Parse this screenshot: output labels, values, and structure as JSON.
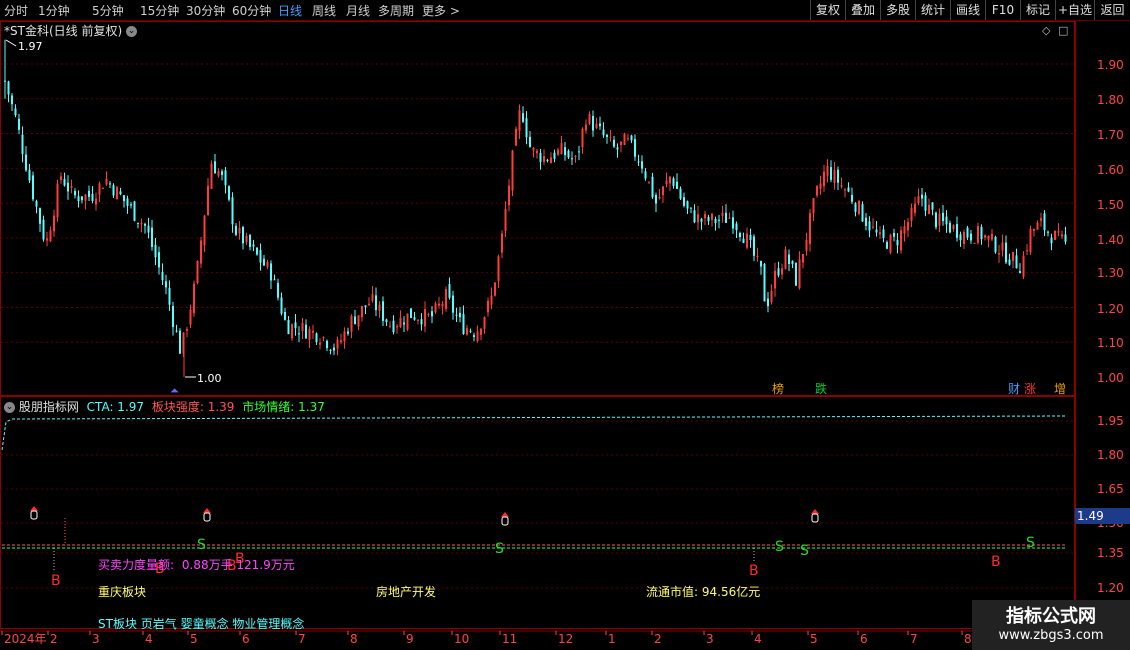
{
  "toolbar": {
    "periods": [
      "分时",
      "1分钟",
      "5分钟",
      "15分钟",
      "30分钟",
      "60分钟",
      "日线",
      "周线",
      "月线",
      "多周期",
      "更多 >"
    ],
    "active_period": "日线",
    "tools": [
      "复权",
      "叠加",
      "多股",
      "统计",
      "画线",
      "F10",
      "标记",
      "+自选",
      "返回"
    ]
  },
  "main_panel": {
    "title": "*ST金科(日线 前复权)",
    "high_label": "1.97",
    "low_label": "1.00",
    "price_axis": [
      "1.90",
      "1.80",
      "1.70",
      "1.60",
      "1.50",
      "1.40",
      "1.30",
      "1.20",
      "1.10",
      "1.00"
    ],
    "markers": [
      {
        "text": "榜",
        "color": "#e8a000"
      },
      {
        "text": "跌",
        "color": "#00cc33"
      },
      {
        "text": "财",
        "color": "#3ea0ff"
      },
      {
        "text": "涨",
        "color": "#ff3333"
      },
      {
        "text": "增",
        "color": "#e8a000"
      }
    ]
  },
  "indicator_panel": {
    "name": "股朋指标网",
    "cta_label": "CTA: 1.97",
    "block_strength": "板块强度: 1.39",
    "market_mood": "市场情绪: 1.37",
    "axis": [
      "1.95",
      "1.80",
      "1.65",
      "1.50",
      "1.35",
      "1.20"
    ],
    "current_value": "1.49",
    "buy_sell_label": "买卖力度量额:",
    "buy_sell_values": "0.88万手  121.9万元",
    "sector": "重庆板块",
    "industry": "房地产开发",
    "float_mv": "流通市值: 94.56亿元",
    "concepts": "ST板块  页岩气  婴童概念  物业管理概念",
    "signals": {
      "b": "B",
      "s": "S"
    }
  },
  "date_axis": [
    "2024年",
    "2",
    "3",
    "4",
    "5",
    "6",
    "7",
    "8",
    "9",
    "10",
    "11",
    "12",
    "1",
    "2",
    "3",
    "4",
    "5",
    "6",
    "7",
    "8"
  ],
  "watermark": {
    "title": "指标公式网",
    "url": "www.zbgs3.com"
  },
  "colors": {
    "up": "#ff3b3b",
    "down": "#54ffff",
    "frame": "#8b0000",
    "cta": "#54ffff",
    "strength": "#ff5555",
    "mood": "#33ff33"
  }
}
